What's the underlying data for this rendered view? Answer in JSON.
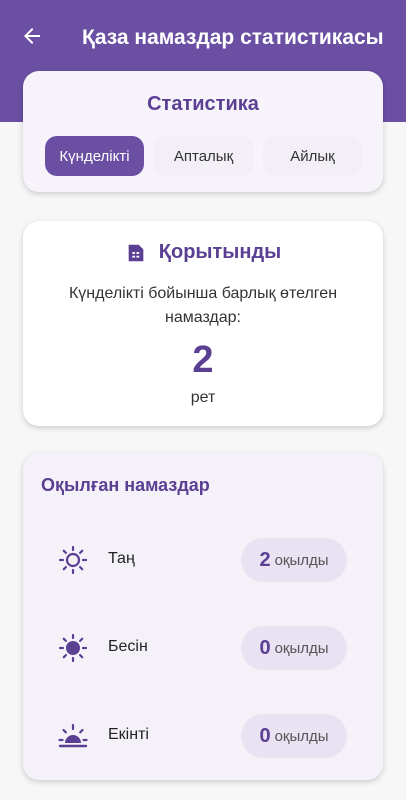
{
  "app_bar": {
    "title": "Қаза намаздар статистикасы"
  },
  "stats": {
    "title": "Статистика",
    "tabs": [
      {
        "label": "Күнделікті",
        "selected": true
      },
      {
        "label": "Апталық",
        "selected": false
      },
      {
        "label": "Айлық",
        "selected": false
      }
    ]
  },
  "result": {
    "heading": "Қорытынды",
    "description": "Күнделікті бойынша барлық өтелген намаздар:",
    "count": "2",
    "unit": "рет"
  },
  "prayers": {
    "title": "Оқылған намаздар",
    "items": [
      {
        "name": "Таң",
        "count": "2",
        "unit": "оқылды",
        "icon": "sunrise-icon"
      },
      {
        "name": "Бесін",
        "count": "0",
        "unit": "оқылды",
        "icon": "sun-icon"
      },
      {
        "name": "Екінті",
        "count": "0",
        "unit": "оқылды",
        "icon": "sunset-icon"
      }
    ]
  },
  "colors": {
    "primary": "#6a4fa3",
    "accent_text": "#5a3f93",
    "pill": "#e9e2f3"
  }
}
